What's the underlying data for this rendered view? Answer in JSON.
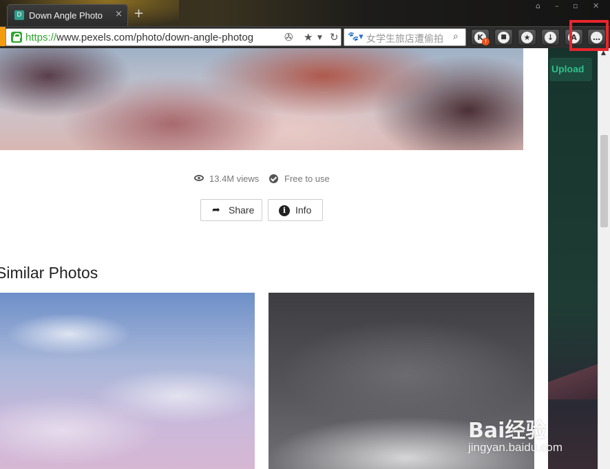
{
  "browser": {
    "tab": {
      "favicon_letter": "D",
      "title": "Down Angle Photo",
      "close": "×"
    },
    "new_tab": "+",
    "window_controls": [
      "⌂",
      "–",
      "▫",
      "✕"
    ],
    "address": {
      "scheme": "https://",
      "rest": "www.pexels.com/photo/down-angle-photog"
    },
    "search": {
      "engine_icon": "paw-icon",
      "placeholder": "女学生旅店遭偷拍"
    },
    "toolbar_buttons": [
      {
        "name": "k-extension",
        "glyph": "K",
        "badge": "!"
      },
      {
        "name": "lock",
        "glyph": "🔒"
      },
      {
        "name": "star",
        "glyph": "★"
      },
      {
        "name": "download",
        "glyph": "↓"
      },
      {
        "name": "key",
        "glyph": "A"
      },
      {
        "name": "more",
        "glyph": "…"
      }
    ]
  },
  "photo": {
    "views": "13.4M views",
    "license": "Free to use",
    "share_label": "Share",
    "info_label": "Info"
  },
  "similar": {
    "title": "Similar Photos"
  },
  "header": {
    "upload_label": "Upload"
  },
  "watermark": {
    "logo": "Bai经验",
    "url": "jingyan.baidu.com"
  },
  "colors": {
    "highlight": "#e8262c",
    "upload_text": "#2fbf8c",
    "secure": "#2ca52c"
  }
}
